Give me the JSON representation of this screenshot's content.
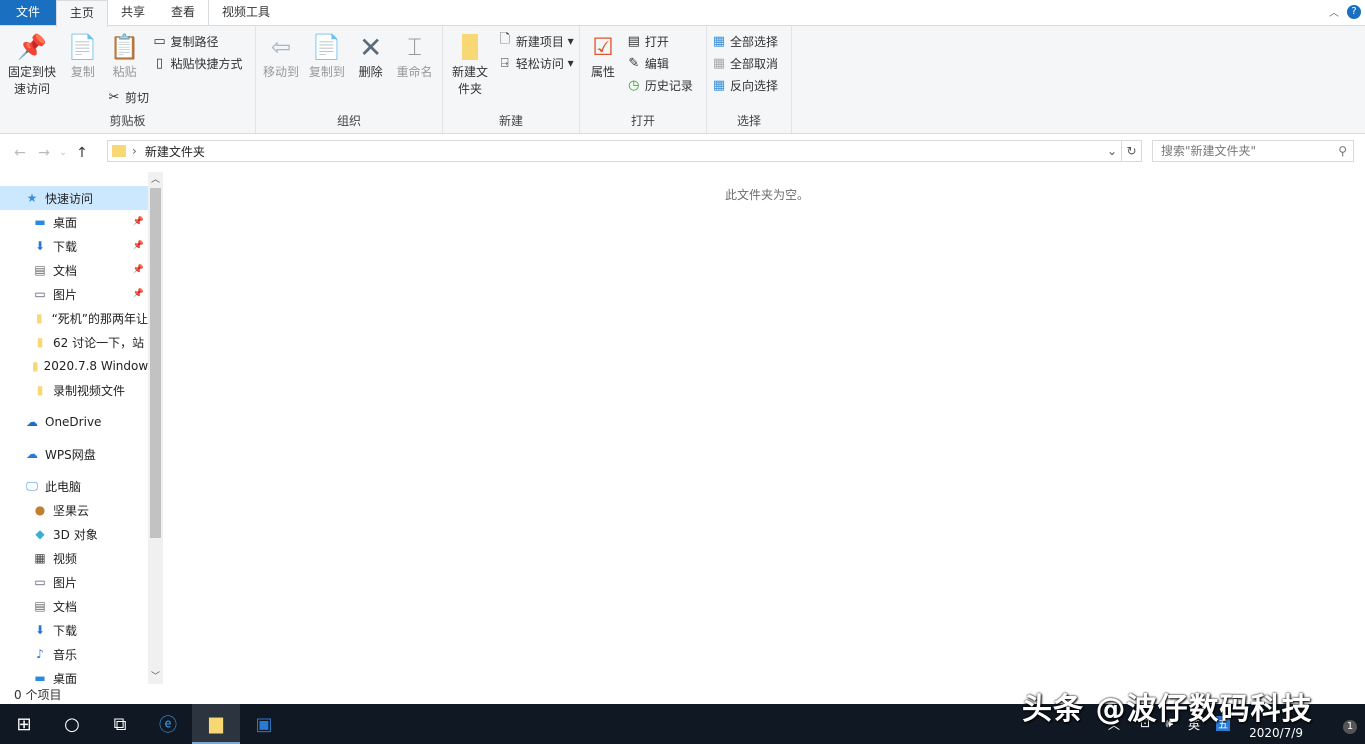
{
  "tabs": [
    "文件",
    "主页",
    "共享",
    "查看",
    "视频工具"
  ],
  "ribbon": {
    "clipboard": {
      "pin": "固定到快速访问",
      "copy": "复制",
      "paste": "粘贴",
      "copy_path": "复制路径",
      "paste_shortcut": "粘贴快捷方式",
      "cut": "剪切",
      "label": "剪贴板"
    },
    "organize": {
      "move_to": "移动到",
      "copy_to": "复制到",
      "delete": "删除",
      "rename": "重命名",
      "label": "组织"
    },
    "new": {
      "new_folder": "新建文件夹",
      "new_item": "新建项目",
      "easy_access": "轻松访问",
      "label": "新建"
    },
    "open": {
      "properties": "属性",
      "open": "打开",
      "edit": "编辑",
      "history": "历史记录",
      "label": "打开"
    },
    "select": {
      "select_all": "全部选择",
      "select_none": "全部取消",
      "invert": "反向选择",
      "label": "选择"
    }
  },
  "address": {
    "path": "新建文件夹",
    "search_placeholder": "搜索\"新建文件夹\""
  },
  "nav": {
    "quick_access": "快速访问",
    "quick_items": [
      {
        "label": "桌面",
        "icon": "desktop"
      },
      {
        "label": "下载",
        "icon": "download"
      },
      {
        "label": "文档",
        "icon": "document"
      },
      {
        "label": "图片",
        "icon": "pictures"
      },
      {
        "label": "“死机”的那两年让",
        "icon": "folder"
      },
      {
        "label": "62 讨论一下，站",
        "icon": "folder"
      },
      {
        "label": "2020.7.8 Window",
        "icon": "folder"
      },
      {
        "label": "录制视频文件",
        "icon": "folder"
      }
    ],
    "onedrive": "OneDrive",
    "wps": "WPS网盘",
    "this_pc": "此电脑",
    "pc_items": [
      {
        "label": "坚果云",
        "icon": "nutstore"
      },
      {
        "label": "3D 对象",
        "icon": "3d"
      },
      {
        "label": "视频",
        "icon": "video"
      },
      {
        "label": "图片",
        "icon": "pictures"
      },
      {
        "label": "文档",
        "icon": "document"
      },
      {
        "label": "下载",
        "icon": "download"
      },
      {
        "label": "音乐",
        "icon": "music"
      },
      {
        "label": "桌面",
        "icon": "desktop"
      }
    ]
  },
  "content": {
    "empty_message": "此文件夹为空。"
  },
  "status": {
    "item_count": "0 个项目"
  },
  "taskbar": {
    "ime_lang": "英",
    "ime_mode": "五",
    "date": "2020/7/9",
    "notification_count": "1"
  },
  "watermark": "头条 @波仔数码科技"
}
